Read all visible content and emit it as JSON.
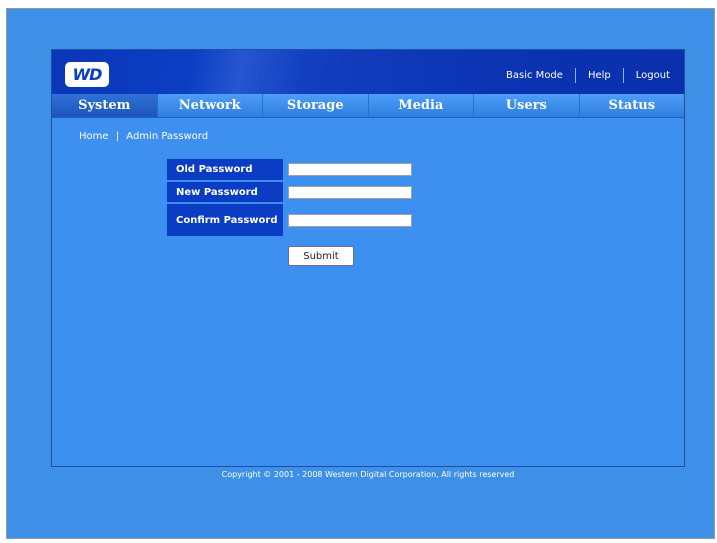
{
  "brand": {
    "logo_text": "WD"
  },
  "top_links": [
    {
      "label": "Basic Mode"
    },
    {
      "label": "Help"
    },
    {
      "label": "Logout"
    }
  ],
  "nav": {
    "tabs": [
      {
        "label": "System",
        "active": true
      },
      {
        "label": "Network",
        "active": false
      },
      {
        "label": "Storage",
        "active": false
      },
      {
        "label": "Media",
        "active": false
      },
      {
        "label": "Users",
        "active": false
      },
      {
        "label": "Status",
        "active": false
      }
    ]
  },
  "breadcrumb": {
    "items": [
      "Home",
      "Admin Password"
    ],
    "separator": "|"
  },
  "form": {
    "fields": [
      {
        "label": "Old Password",
        "value": ""
      },
      {
        "label": "New Password",
        "value": ""
      },
      {
        "label": "Confirm Password",
        "value": ""
      }
    ],
    "submit_label": "Submit"
  },
  "footer": {
    "copyright": "Copyright © 2001 - 2008 Western Digital Corporation, All rights reserved"
  },
  "colors": {
    "page_background": "#3e8fe6",
    "header_background": "#0a36b8",
    "nav_background": "#3f8ef0",
    "label_background": "#0a3cc4",
    "text": "#ffffff"
  }
}
